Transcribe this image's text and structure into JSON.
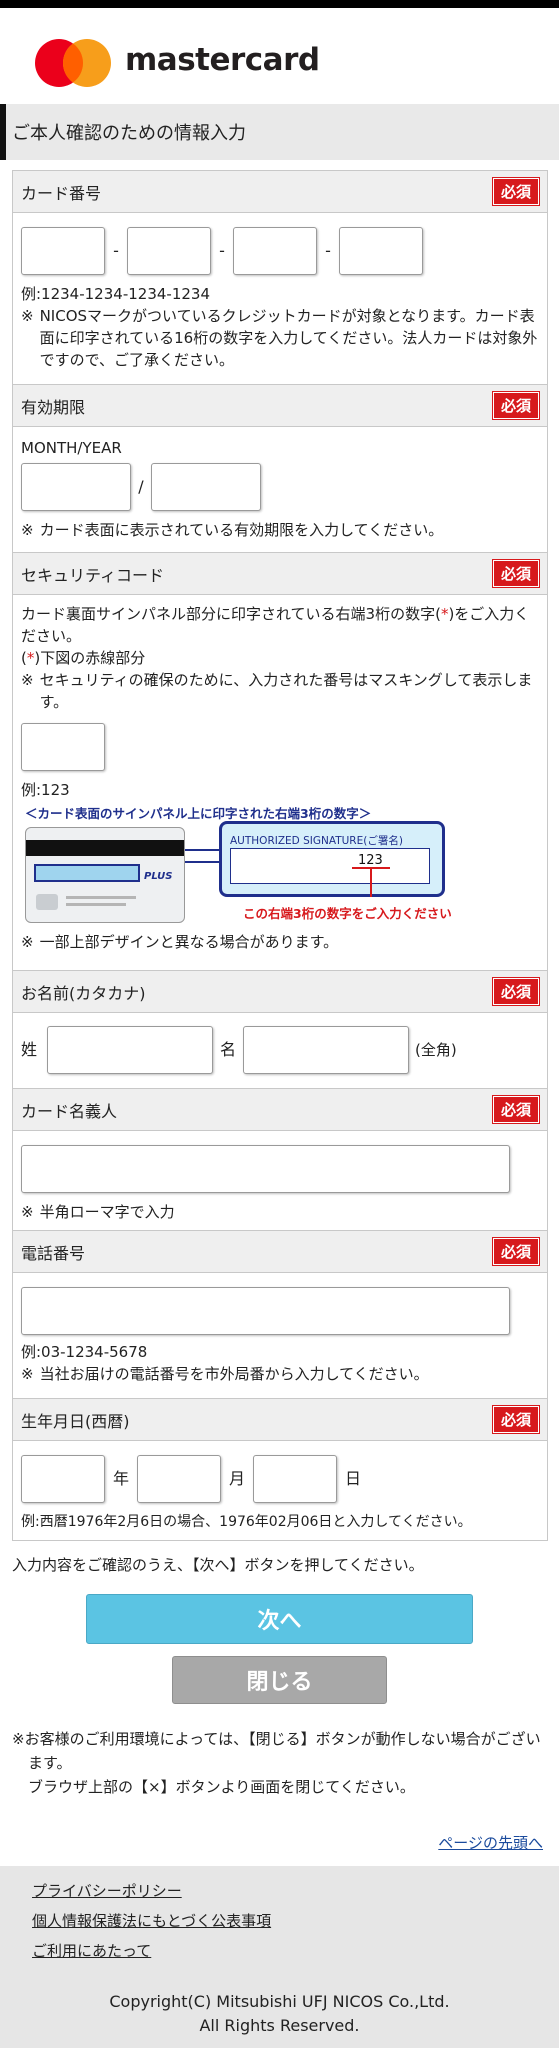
{
  "brand": {
    "name": "mastercard",
    "colors": {
      "red": "#eb001b",
      "orange": "#f79e1b",
      "overlap": "#ff5f00"
    }
  },
  "page_title": "ご本人確認のための情報入力",
  "required_label": "必須",
  "sections": {
    "card_number": {
      "title": "カード番号",
      "separator": "-",
      "example": "例:1234-1234-1234-1234",
      "note_mark": "※",
      "note": "NICOSマークがついているクレジットカードが対象となります。カード表面に印字されている16桁の数字を入力してください。法人カードは対象外ですので、ご了承ください。"
    },
    "expiry": {
      "title": "有効期限",
      "format_label": "MONTH/YEAR",
      "separator": "/",
      "note_mark": "※",
      "note": "カード表面に表示されている有効期限を入力してください。"
    },
    "security_code": {
      "title": "セキュリティコード",
      "desc_before": "カード裏面サインパネル部分に印字されている右端3桁の数字(",
      "desc_star": "*",
      "desc_after": ")をご入力ください。",
      "ref_open": "(",
      "ref_star": "*",
      "ref_after": ")下図の赤線部分",
      "note_mark": "※",
      "note": "セキュリティの確保のために、入力された番号はマスキングして表示します。",
      "example": "例:123",
      "image": {
        "caption_top": "＜カード表面のサインパネル上に印字された右端3桁の数字＞",
        "signature_label": "AUTHORIZED SIGNATURE(ご署名)",
        "digits": "123",
        "caption_bottom": "この右端3桁の数字をご入力ください",
        "plus_label": "PLUS"
      },
      "design_note_mark": "※",
      "design_note": "一部上部デザインと異なる場合があります。"
    },
    "name_kana": {
      "title": "お名前(カタカナ)",
      "last_label": "姓",
      "first_label": "名",
      "width_note": "(全角)"
    },
    "card_holder": {
      "title": "カード名義人",
      "note_mark": "※",
      "note": "半角ローマ字で入力"
    },
    "phone": {
      "title": "電話番号",
      "example": "例:03-1234-5678",
      "note_mark": "※",
      "note": "当社お届けの電話番号を市外局番から入力してください。"
    },
    "birthdate": {
      "title": "生年月日(西暦)",
      "year_label": "年",
      "month_label": "月",
      "day_label": "日",
      "example": "例:西暦1976年2月6日の場合、1976年02月06日と入力してください。"
    }
  },
  "confirm_notice": "入力内容をご確認のうえ、【次へ】ボタンを押してください。",
  "buttons": {
    "next": "次へ",
    "close": "閉じる"
  },
  "env_note_line1": "※お客様のご利用環境によっては、【閉じる】ボタンが動作しない場合がございます。",
  "env_note_line2": "ブラウザ上部の【×】ボタンより画面を閉じてください。",
  "to_top": "ページの先頭へ",
  "footer": {
    "links": [
      "プライバシーポリシー",
      "個人情報保護法にもとづく公表事項",
      "ご利用にあたって"
    ],
    "copyright_line1": "Copyright(C) Mitsubishi UFJ NICOS Co.,Ltd.",
    "copyright_line2": "All Rights Reserved."
  }
}
